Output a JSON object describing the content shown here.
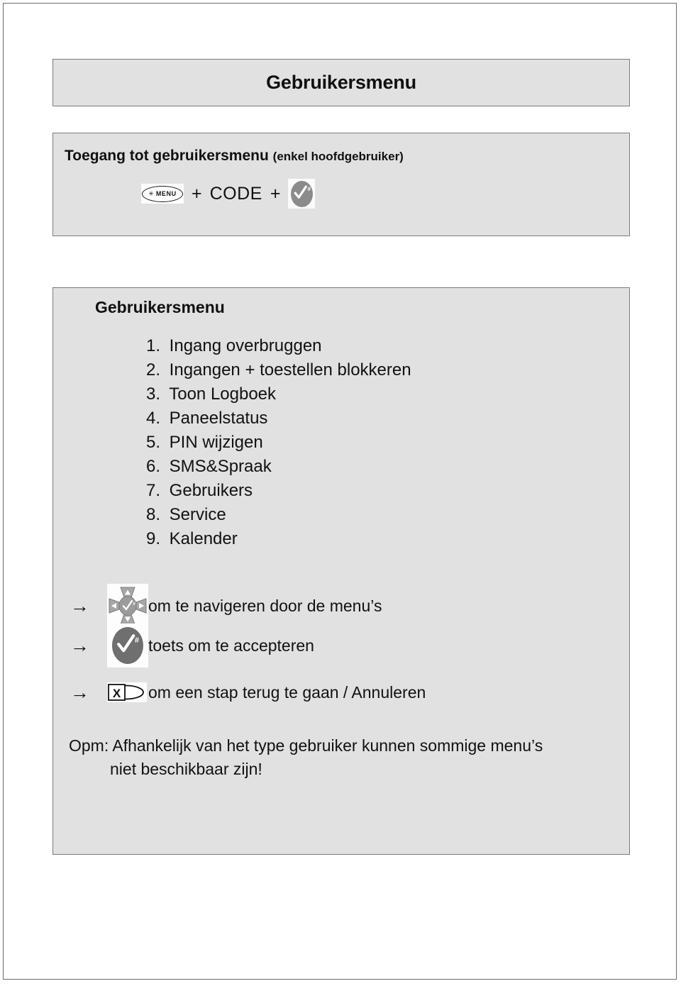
{
  "document": {
    "title": "Gebruikersmenu"
  },
  "access_section": {
    "heading_main": "Toegang tot gebruikersmenu",
    "heading_sub": "(enkel hoofdgebruiker)",
    "sequence": {
      "menu_key_star": "✳",
      "menu_key_label": "MENU",
      "plus_1": "+",
      "code_label": "CODE",
      "plus_2": "+",
      "accept_key_icon": "check-key"
    }
  },
  "menu_section": {
    "heading": "Gebruikersmenu",
    "items": [
      {
        "number": "1.",
        "label": "Ingang overbruggen"
      },
      {
        "number": "2.",
        "label": "Ingangen + toestellen blokkeren"
      },
      {
        "number": "3.",
        "label": "Toon Logboek"
      },
      {
        "number": "4.",
        "label": "Paneelstatus"
      },
      {
        "number": "5.",
        "label": "PIN wijzigen"
      },
      {
        "number": "6.",
        "label": "SMS&Spraak"
      },
      {
        "number": "7.",
        "label": "Gebruikers"
      },
      {
        "number": "8.",
        "label": "Service"
      },
      {
        "number": "9.",
        "label": "Kalender"
      }
    ],
    "legend": [
      {
        "arrow": "→",
        "key": "dpad-navigation-key",
        "text": "om te navigeren door de menu’s"
      },
      {
        "arrow": "→",
        "key": "check-hash-key",
        "hash": "#",
        "text": "toets om te accepteren"
      },
      {
        "arrow": "→",
        "key": "cancel-x-key",
        "key_label": "X",
        "text": "om een stap terug te gaan  / Annuleren"
      }
    ],
    "note": {
      "line1": "Opm: Afhankelijk van het type gebruiker kunnen sommige menu’s",
      "line2": "niet beschikbaar zijn!"
    }
  },
  "colors": {
    "panel_fill": "#e1e1e1",
    "panel_border": "#7c7c7c",
    "page_border": "#6b6b6b",
    "key_grey": "#8b8b8b",
    "text": "#111111"
  }
}
